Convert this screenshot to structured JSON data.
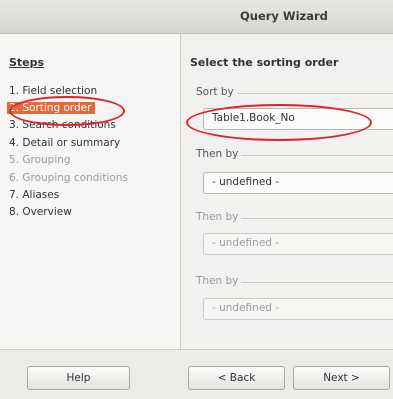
{
  "window": {
    "title": "Query Wizard"
  },
  "steps": {
    "heading": "Steps",
    "items": [
      {
        "label": "1. Field selection",
        "state": "normal"
      },
      {
        "label": "2. Sorting order",
        "state": "current"
      },
      {
        "label": "3. Search conditions",
        "state": "normal"
      },
      {
        "label": "4. Detail or summary",
        "state": "normal"
      },
      {
        "label": "5. Grouping",
        "state": "disabled"
      },
      {
        "label": "6. Grouping conditions",
        "state": "disabled"
      },
      {
        "label": "7. Aliases",
        "state": "normal"
      },
      {
        "label": "8. Overview",
        "state": "normal"
      }
    ]
  },
  "main": {
    "heading": "Select the sorting order",
    "groups": [
      {
        "label": "Sort by",
        "value": "Table1.Book_No",
        "enabled": true
      },
      {
        "label": "Then by",
        "value": "- undefined -",
        "enabled": true
      },
      {
        "label": "Then by",
        "value": "- undefined -",
        "enabled": false
      },
      {
        "label": "Then by",
        "value": "- undefined -",
        "enabled": false
      }
    ]
  },
  "buttons": {
    "help": "Help",
    "back": "< Back",
    "next": "Next >"
  },
  "colors": {
    "current_step_bg": "#e06a3a",
    "annotation": "#e0202a"
  }
}
